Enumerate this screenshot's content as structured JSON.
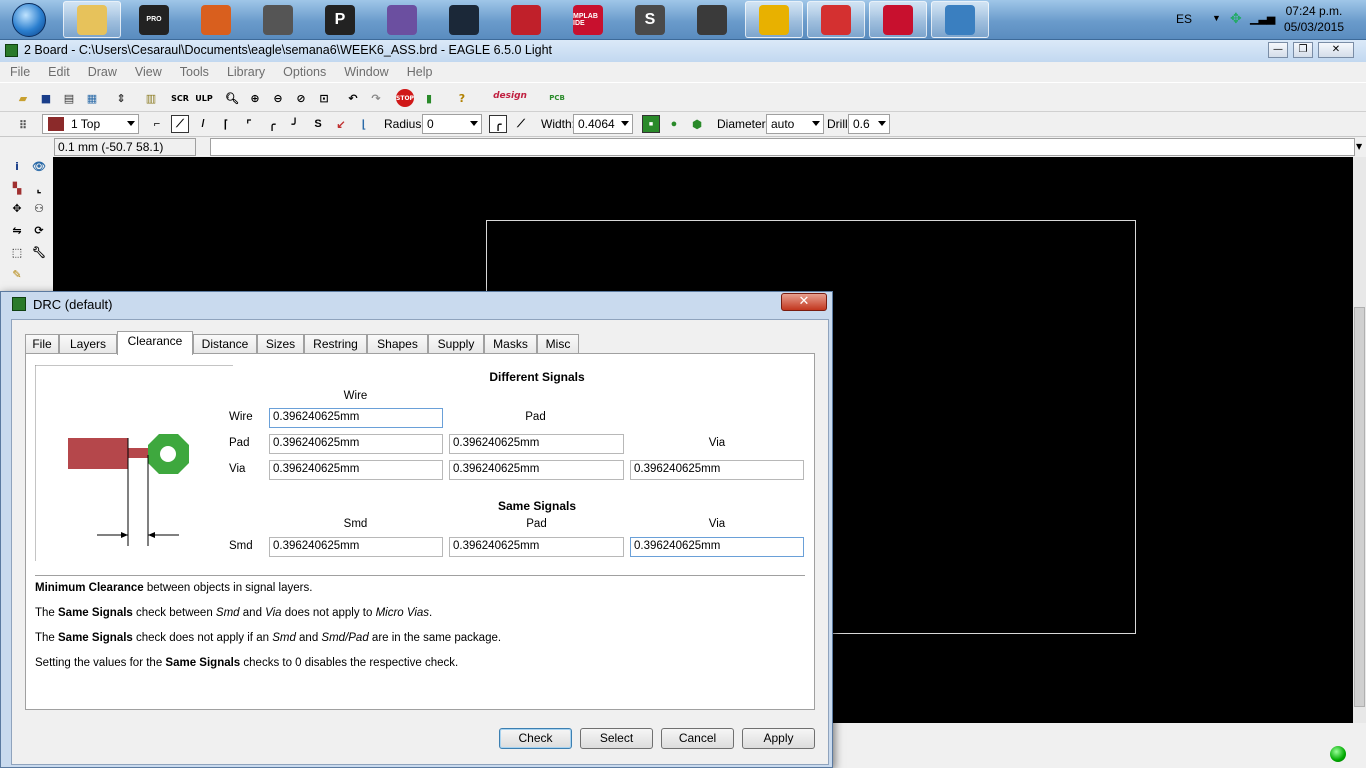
{
  "taskbar": {
    "apps": [
      {
        "name": "explorer",
        "icon": "folder-icon",
        "active": true,
        "color": "#e7c25b"
      },
      {
        "name": "eagle-pro",
        "icon": "eagle-pro-icon",
        "active": false,
        "color": "#222222",
        "text": "PRO"
      },
      {
        "name": "matlab",
        "icon": "matlab-icon",
        "active": false,
        "color": "#d95f1e"
      },
      {
        "name": "inkscape",
        "icon": "inkscape-icon",
        "active": false,
        "color": "#555555"
      },
      {
        "name": "pidgin",
        "icon": "p-icon",
        "active": false,
        "color": "#222222",
        "text": "P"
      },
      {
        "name": "app6",
        "icon": "equalizer-icon",
        "active": false,
        "color": "#6b4fa0"
      },
      {
        "name": "steam",
        "icon": "steam-icon",
        "active": false,
        "color": "#1b2838"
      },
      {
        "name": "autocad",
        "icon": "autocad-icon",
        "active": false,
        "color": "#c0202a"
      },
      {
        "name": "mplab",
        "icon": "mplab-ide-icon",
        "active": false,
        "color": "#c8102e",
        "text": "MPLAB IDE"
      },
      {
        "name": "sublime",
        "icon": "sublime-icon",
        "active": false,
        "color": "#4a4a4a",
        "text": "S"
      },
      {
        "name": "app11",
        "icon": "wrench-icon",
        "active": false,
        "color": "#3a3a3a"
      },
      {
        "name": "chrome",
        "icon": "chrome-icon",
        "active": true,
        "color": "#e8b100"
      },
      {
        "name": "eagle",
        "icon": "eagle-icon",
        "active": true,
        "color": "#d43030"
      },
      {
        "name": "acrobat",
        "icon": "acrobat-icon",
        "active": true,
        "color": "#c8102e"
      },
      {
        "name": "photos",
        "icon": "image-viewer-icon",
        "active": true,
        "color": "#3a7fc0"
      }
    ],
    "language": "ES",
    "time": "07:24 p.m.",
    "date": "05/03/2015"
  },
  "window": {
    "title": "2 Board - C:\\Users\\Cesaraul\\Documents\\eagle\\semana6\\WEEK6_ASS.brd - EAGLE 6.5.0 Light",
    "min": "—",
    "max": "❐",
    "close": "✕"
  },
  "menu": [
    "File",
    "Edit",
    "Draw",
    "View",
    "Tools",
    "Library",
    "Options",
    "Window",
    "Help"
  ],
  "toolbar2": {
    "layer": "1 Top",
    "radius_label": "Radius:",
    "radius": "0",
    "width_label": "Width:",
    "width": "0.4064",
    "diameter_label": "Diameter:",
    "diameter": "auto",
    "drill_label": "Drill:",
    "drill": "0.6"
  },
  "coord": "0.1 mm (-50.7 58.1)",
  "dialog": {
    "title": "DRC (default)",
    "close": "✕",
    "tabs": [
      "File",
      "Layers",
      "Clearance",
      "Distance",
      "Sizes",
      "Restring",
      "Shapes",
      "Supply",
      "Masks",
      "Misc"
    ],
    "selected_tab": "Clearance",
    "different_signals": "Different Signals",
    "same_signals": "Same Signals",
    "diff": {
      "col_wire": "Wire",
      "col_pad": "Pad",
      "col_via": "Via",
      "row_wire": "Wire",
      "row_pad": "Pad",
      "row_via": "Via",
      "wire_wire": "0.396240625mm",
      "pad_wire": "0.396240625mm",
      "pad_pad": "0.396240625mm",
      "via_wire": "0.396240625mm",
      "via_pad": "0.396240625mm",
      "via_via": "0.396240625mm"
    },
    "same": {
      "col_smd": "Smd",
      "col_pad": "Pad",
      "col_via": "Via",
      "row_smd": "Smd",
      "smd_smd": "0.396240625mm",
      "smd_pad": "0.396240625mm",
      "smd_via": "0.396240625mm"
    },
    "notes": {
      "n1_b": "Minimum Clearance",
      "n1_rest": " between objects in signal layers.",
      "n2_a": "The ",
      "n2_b": "Same Signals",
      "n2_c": " check between ",
      "n2_i1": "Smd",
      "n2_d": " and ",
      "n2_i2": "Via",
      "n2_e": " does not apply to ",
      "n2_i3": "Micro Vias",
      "n2_f": ".",
      "n3_a": "The ",
      "n3_b": "Same Signals",
      "n3_c": " check does not apply if an ",
      "n3_i1": "Smd",
      "n3_d": " and ",
      "n3_i2": "Smd/Pad",
      "n3_e": " are in the same package.",
      "n4_a": "Setting the values for the ",
      "n4_b": "Same Signals",
      "n4_c": " checks to 0 disables the respective check."
    },
    "buttons": {
      "check": "Check",
      "select": "Select",
      "cancel": "Cancel",
      "apply": "Apply"
    },
    "colors": {
      "pad": "#b5474b",
      "via": "#3ea83e"
    }
  }
}
